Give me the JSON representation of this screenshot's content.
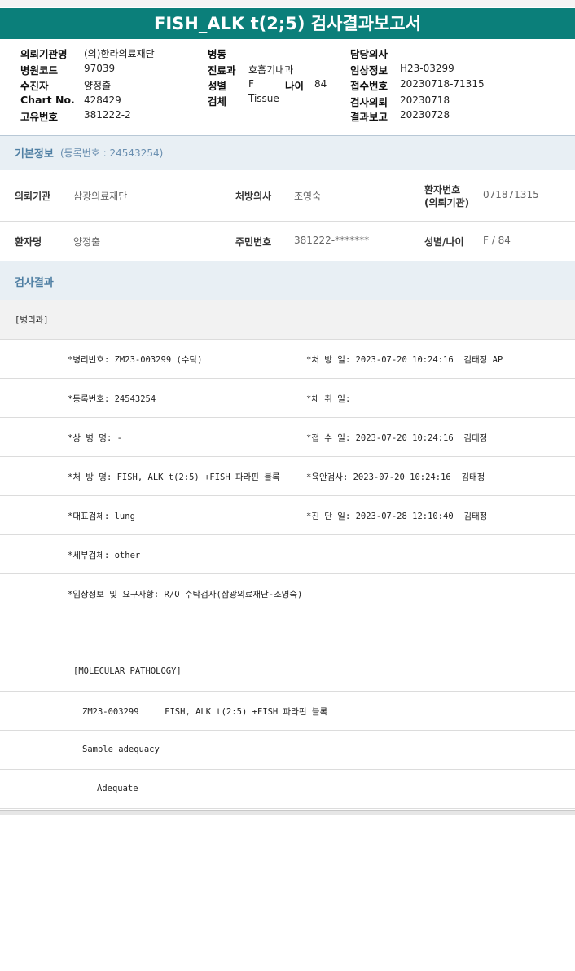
{
  "title": "FISH_ALK t(2;5) 검사결과보고서",
  "header": {
    "col1": [
      {
        "label": "의뢰기관명",
        "value": "(의)한라의료재단"
      },
      {
        "label": "병원코드",
        "value": "97039"
      },
      {
        "label": "수진자",
        "value": "양정출"
      },
      {
        "label": "Chart No.",
        "value": "428429"
      },
      {
        "label": "고유번호",
        "value": "381222-2"
      }
    ],
    "col2": [
      {
        "label": "병동",
        "value": ""
      },
      {
        "label": "진료과",
        "value": "호흡기내과"
      },
      {
        "label": "성별",
        "value": "F"
      },
      {
        "label": "검체",
        "value": "Tissue"
      }
    ],
    "age_label": "나이",
    "age_value": "84",
    "col3": [
      {
        "label": "담당의사",
        "value": ""
      },
      {
        "label": "임상정보",
        "value": "H23-03299"
      },
      {
        "label": "접수번호",
        "value": "20230718-71315"
      },
      {
        "label": "검사의뢰",
        "value": "20230718"
      },
      {
        "label": "결과보고",
        "value": "20230728"
      }
    ]
  },
  "basic": {
    "title": "기본정보",
    "sub": "(등록번호 : 24543254)",
    "row1": {
      "l1": "의뢰기관",
      "v1": "삼광의료재단",
      "l2": "처방의사",
      "v2": "조영숙",
      "l3a": "환자번호",
      "l3b": "(의뢰기관)",
      "v3": "071871315"
    },
    "row2": {
      "l1": "환자명",
      "v1": "양정출",
      "l2": "주민번호",
      "v2": "381222-*******",
      "l3": "성별/나이",
      "v3": "F / 84"
    }
  },
  "results": {
    "title": "검사결과",
    "dept": "[병리과]",
    "rows": [
      {
        "left": "*병리번호: ZM23-003299 (수탁)",
        "right": "*처 방 일: 2023-07-20 10:24:16  김태정 AP"
      },
      {
        "left": "*등록번호: 24543254",
        "right": "*채 취 일:"
      },
      {
        "left": "*상 병 명: -",
        "right": "*접 수 일: 2023-07-20 10:24:16  김태정"
      },
      {
        "left": "*처 방 명: FISH, ALK t(2:5) +FISH 파라핀 블록",
        "right": "*육안검사: 2023-07-20 10:24:16  김태정"
      },
      {
        "left": "*대표검체: lung",
        "right": "*진 단 일: 2023-07-28 12:10:40  김태정"
      },
      {
        "left": "*세부검체: other",
        "right": ""
      },
      {
        "left": "*임상정보 및 요구사항: R/O 수탁검사(삼광의료재단-조영숙)",
        "right": ""
      },
      {
        "left": "",
        "right": ""
      },
      {
        "left": "[MOLECULAR PATHOLOGY]",
        "right": ""
      },
      {
        "left": "ZM23-003299     FISH, ALK t(2:5) +FISH 파라핀 블록",
        "right": ""
      },
      {
        "left": "Sample adequacy",
        "right": ""
      },
      {
        "left": "Adequate",
        "right": ""
      }
    ]
  },
  "colors": {
    "title_bar": "#0b7f7a",
    "section_head_bg": "#e8eff4",
    "section_head_text": "#4f7fa3"
  }
}
